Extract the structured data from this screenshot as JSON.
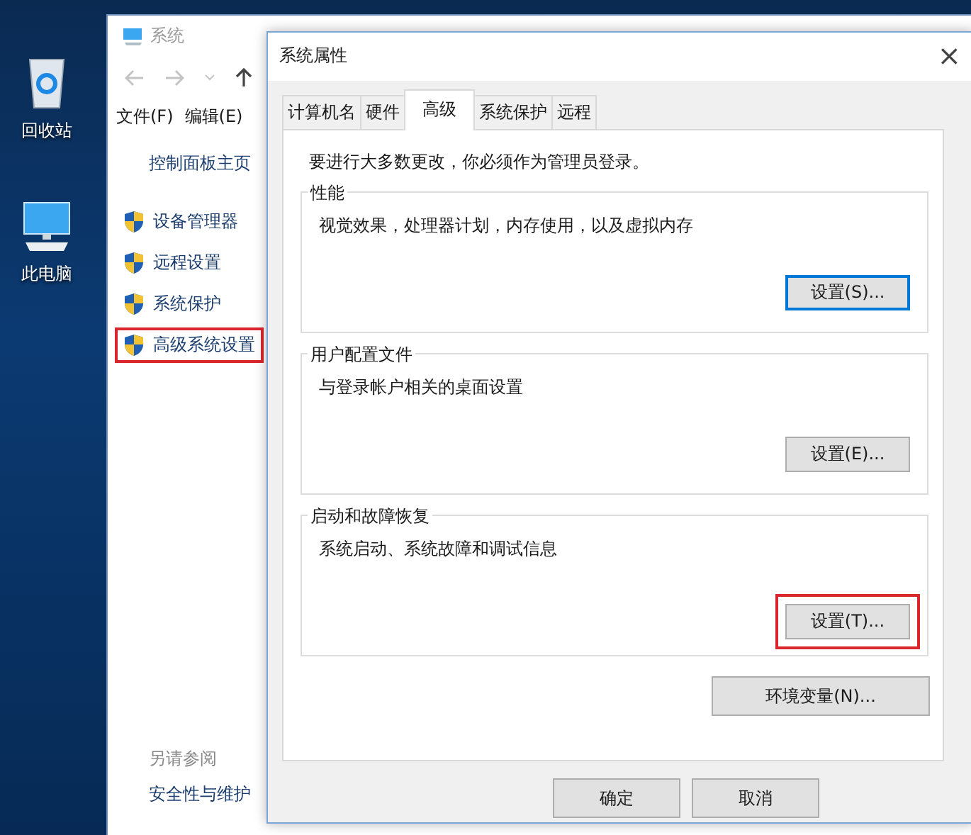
{
  "desktop_icons": [
    {
      "kind": "recycle-bin",
      "label": "回收站"
    },
    {
      "kind": "computer",
      "label": "此电脑"
    }
  ],
  "explorer": {
    "title": "系统",
    "menu": [
      "文件(F)",
      "编辑(E)"
    ],
    "home_link": "控制面板主页",
    "sidebar_items": [
      {
        "label": "设备管理器",
        "highlighted": false
      },
      {
        "label": "远程设置",
        "highlighted": false
      },
      {
        "label": "系统保护",
        "highlighted": false
      },
      {
        "label": "高级系统设置",
        "highlighted": true
      }
    ],
    "see_also": {
      "heading": "另请参阅",
      "links": [
        "安全性与维护"
      ]
    }
  },
  "dialog": {
    "title": "系统属性",
    "close": "×",
    "tabs": [
      {
        "label": "计算机名",
        "selected": false
      },
      {
        "label": "硬件",
        "selected": false
      },
      {
        "label": "高级",
        "selected": true
      },
      {
        "label": "系统保护",
        "selected": false
      },
      {
        "label": "远程",
        "selected": false
      }
    ],
    "notice": "要进行大多数更改，你必须作为管理员登录。",
    "groups": [
      {
        "title": "性能",
        "description": "视觉效果，处理器计划，内存使用，以及虚拟内存",
        "button": {
          "label": "设置(S)...",
          "focused": true,
          "highlighted": false
        }
      },
      {
        "title": "用户配置文件",
        "description": "与登录帐户相关的桌面设置",
        "button": {
          "label": "设置(E)...",
          "focused": false,
          "highlighted": false
        }
      },
      {
        "title": "启动和故障恢复",
        "description": "系统启动、系统故障和调试信息",
        "button": {
          "label": "设置(T)...",
          "focused": false,
          "highlighted": true
        }
      }
    ],
    "env_button": "环境变量(N)...",
    "footer_buttons": [
      "确定",
      "取消"
    ]
  }
}
